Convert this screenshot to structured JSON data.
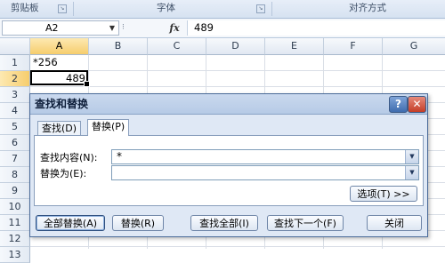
{
  "ribbon": {
    "groups": [
      {
        "label": "剪贴板"
      },
      {
        "label": "字体"
      },
      {
        "label": "对齐方式"
      }
    ]
  },
  "formula_bar": {
    "name_box": "A2",
    "fx_label": "fx",
    "formula": "489"
  },
  "grid": {
    "columns": [
      "A",
      "B",
      "C",
      "D",
      "E",
      "F",
      "G"
    ],
    "rows": [
      "1",
      "2",
      "3",
      "4",
      "5",
      "6",
      "7",
      "8",
      "9",
      "10",
      "11",
      "12",
      "13"
    ],
    "selected_cell": "A2",
    "cells": {
      "A1": "*256",
      "A2": "489"
    }
  },
  "dialog": {
    "title": "查找和替换",
    "help_label": "?",
    "close_label": "✕",
    "tabs": [
      {
        "label": "查找(D)",
        "active": false
      },
      {
        "label": "替换(P)",
        "active": true
      }
    ],
    "find_label": "查找内容(N):",
    "find_value": "*",
    "replace_label": "替换为(E):",
    "replace_value": "",
    "options_button": "选项(T) >>",
    "buttons": {
      "replace_all": "全部替换(A)",
      "replace": "替换(R)",
      "find_all": "查找全部(I)",
      "find_next": "查找下一个(F)",
      "close": "关闭"
    }
  }
}
